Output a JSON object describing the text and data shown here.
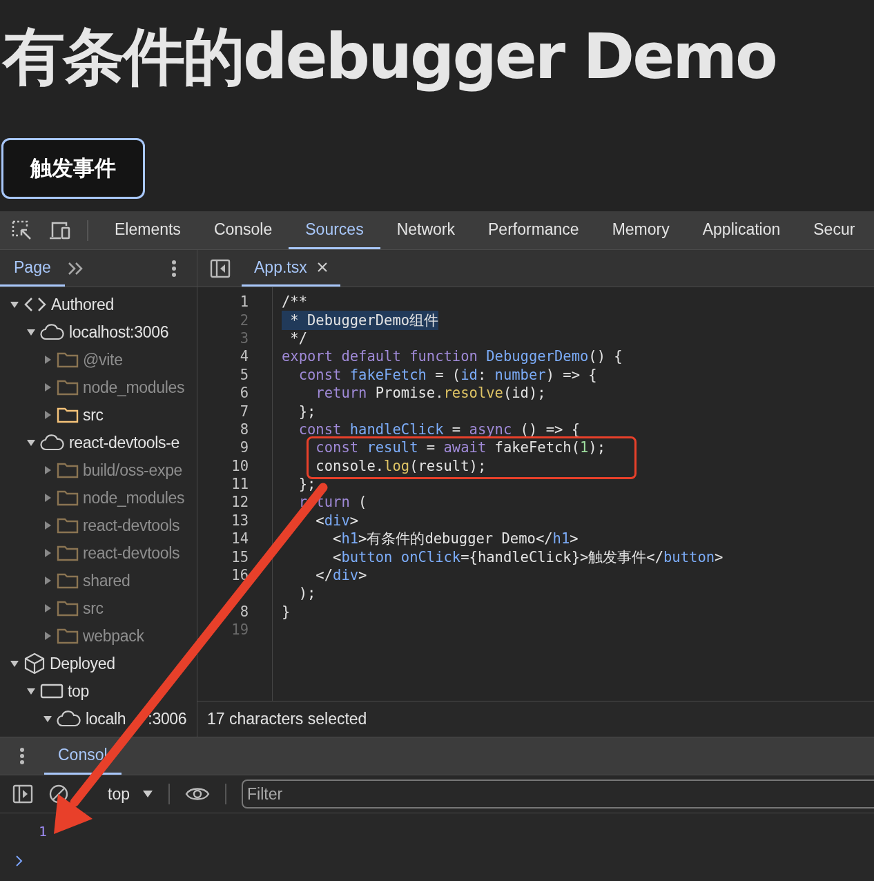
{
  "page": {
    "heading": "有条件的debugger Demo",
    "button": "触发事件"
  },
  "devtools": {
    "tabs": [
      {
        "label": "Elements",
        "selected": false
      },
      {
        "label": "Console",
        "selected": false
      },
      {
        "label": "Sources",
        "selected": true
      },
      {
        "label": "Network",
        "selected": false
      },
      {
        "label": "Performance",
        "selected": false
      },
      {
        "label": "Memory",
        "selected": false
      },
      {
        "label": "Application",
        "selected": false
      },
      {
        "label": "Secur",
        "selected": false
      }
    ],
    "navigator": {
      "tab": {
        "label": "Page",
        "selected": true
      },
      "tree": [
        {
          "label": "Authored",
          "kind": "code",
          "expanded": true,
          "children": [
            {
              "label": "localhost:3006",
              "kind": "cloud",
              "expanded": true,
              "children": [
                {
                  "label": "@vite",
                  "kind": "folder",
                  "expanded": false,
                  "dimmed": true
                },
                {
                  "label": "node_modules",
                  "kind": "folder",
                  "expanded": false,
                  "dimmed": true
                },
                {
                  "label": "src",
                  "kind": "folder",
                  "expanded": false,
                  "dimmed": false
                }
              ]
            },
            {
              "label": "react-devtools-e",
              "kind": "cloud",
              "expanded": true,
              "children": [
                {
                  "label": "build/oss-expe",
                  "kind": "folder",
                  "expanded": false,
                  "dimmed": true
                },
                {
                  "label": "node_modules",
                  "kind": "folder",
                  "expanded": false,
                  "dimmed": true
                },
                {
                  "label": "react-devtools",
                  "kind": "folder",
                  "expanded": false,
                  "dimmed": true
                },
                {
                  "label": "react-devtools",
                  "kind": "folder",
                  "expanded": false,
                  "dimmed": true
                },
                {
                  "label": "shared",
                  "kind": "folder",
                  "expanded": false,
                  "dimmed": true
                },
                {
                  "label": "src",
                  "kind": "folder",
                  "expanded": false,
                  "dimmed": true
                },
                {
                  "label": "webpack",
                  "kind": "folder",
                  "expanded": false,
                  "dimmed": true
                }
              ]
            }
          ]
        },
        {
          "label": "Deployed",
          "kind": "box",
          "expanded": true,
          "children": [
            {
              "label": "top",
              "kind": "frame",
              "expanded": true,
              "children": [
                {
                  "label": "localh",
                  "label_end": ":3006",
                  "kind": "cloud",
                  "expanded": true
                }
              ]
            }
          ]
        }
      ]
    },
    "editor": {
      "file_tab": {
        "label": "App.tsx",
        "selected": true
      },
      "lines": [
        {
          "number": "1",
          "dimmed": false,
          "tokens": [
            {
              "kind": "plain",
              "text": "/**"
            }
          ]
        },
        {
          "number": "2",
          "dimmed": true,
          "highlighted": true,
          "tokens": [
            {
              "kind": "plain",
              "text": " * DebuggerDemo组件"
            }
          ]
        },
        {
          "number": "3",
          "dimmed": true,
          "tokens": [
            {
              "kind": "plain",
              "text": " */"
            }
          ]
        },
        {
          "number": "4",
          "dimmed": false,
          "tokens": [
            {
              "kind": "keyword",
              "text": "export default function "
            },
            {
              "kind": "name",
              "text": "DebuggerDemo"
            },
            {
              "kind": "plain",
              "text": "() {"
            }
          ]
        },
        {
          "number": "5",
          "dimmed": false,
          "tokens": [
            {
              "kind": "keyword",
              "text": "  const "
            },
            {
              "kind": "name",
              "text": "fakeFetch"
            },
            {
              "kind": "plain",
              "text": " = ("
            },
            {
              "kind": "name",
              "text": "id"
            },
            {
              "kind": "plain",
              "text": ": "
            },
            {
              "kind": "name",
              "text": "number"
            },
            {
              "kind": "plain",
              "text": ") => {"
            }
          ]
        },
        {
          "number": "6",
          "dimmed": false,
          "tokens": [
            {
              "kind": "keyword",
              "text": "    return "
            },
            {
              "kind": "plain",
              "text": "Promise."
            },
            {
              "kind": "method",
              "text": "resolve"
            },
            {
              "kind": "plain",
              "text": "(id);"
            }
          ]
        },
        {
          "number": "7",
          "dimmed": false,
          "tokens": [
            {
              "kind": "plain",
              "text": "  };"
            }
          ]
        },
        {
          "number": "8",
          "dimmed": false,
          "tokens": [
            {
              "kind": "keyword",
              "text": "  const "
            },
            {
              "kind": "name",
              "text": "handleClick"
            },
            {
              "kind": "plain",
              "text": " = "
            },
            {
              "kind": "keyword",
              "text": "async"
            },
            {
              "kind": "plain",
              "text": " () => {"
            }
          ]
        },
        {
          "number": "9",
          "dimmed": false,
          "tokens": [
            {
              "kind": "keyword",
              "text": "    const "
            },
            {
              "kind": "name",
              "text": "result"
            },
            {
              "kind": "plain",
              "text": " = "
            },
            {
              "kind": "keyword",
              "text": "await "
            },
            {
              "kind": "plain",
              "text": "fakeFetch("
            },
            {
              "kind": "number",
              "text": "1"
            },
            {
              "kind": "plain",
              "text": ");"
            }
          ]
        },
        {
          "number": "10",
          "dimmed": false,
          "tokens": [
            {
              "kind": "plain",
              "text": "    console."
            },
            {
              "kind": "method",
              "text": "log"
            },
            {
              "kind": "plain",
              "text": "(result);"
            }
          ]
        },
        {
          "number": "11",
          "dimmed": false,
          "tokens": [
            {
              "kind": "plain",
              "text": "  };"
            }
          ]
        },
        {
          "number": "12",
          "dimmed": false,
          "tokens": [
            {
              "kind": "keyword",
              "text": "  r"
            },
            {
              "kind": "keyword",
              "text": "turn",
              "after_gap": true
            },
            {
              "kind": "plain",
              "text": " ("
            }
          ]
        },
        {
          "number": "13",
          "dimmed": false,
          "tokens": [
            {
              "kind": "plain",
              "text": "    <"
            },
            {
              "kind": "name",
              "text": "div"
            },
            {
              "kind": "plain",
              "text": ">"
            }
          ]
        },
        {
          "number": "14",
          "dimmed": false,
          "tokens": [
            {
              "kind": "plain",
              "text": "      <"
            },
            {
              "kind": "name",
              "text": "h1"
            },
            {
              "kind": "plain",
              "text": ">有条件的debugger Demo</"
            },
            {
              "kind": "name",
              "text": "h1"
            },
            {
              "kind": "plain",
              "text": ">"
            }
          ]
        },
        {
          "number": "15",
          "dimmed": false,
          "tokens": [
            {
              "kind": "plain",
              "text": "      <"
            },
            {
              "kind": "name",
              "text": "button onClick"
            },
            {
              "kind": "plain",
              "text": "={handleClick}>触发事件</"
            },
            {
              "kind": "name",
              "text": "button"
            },
            {
              "kind": "plain",
              "text": ">"
            }
          ]
        },
        {
          "number": "16",
          "dimmed": false,
          "tokens": [
            {
              "kind": "plain",
              "text": "    </"
            },
            {
              "kind": "name",
              "text": "div"
            },
            {
              "kind": "plain",
              "text": ">"
            }
          ]
        },
        {
          "tokens": [
            {
              "kind": "plain",
              "text": "  );"
            }
          ]
        },
        {
          "number": "8",
          "dimmed": false,
          "tokens": [
            {
              "kind": "plain",
              "text": "}"
            }
          ]
        },
        {
          "number": "19",
          "dimmed": true
        }
      ],
      "status": "17 characters selected"
    }
  },
  "drawer": {
    "tab": {
      "label": "Consol",
      "selected": true
    },
    "context": "top",
    "filter": {
      "placeholder": "Filter"
    },
    "output": [
      {
        "kind": "number",
        "text": "1"
      }
    ]
  }
}
